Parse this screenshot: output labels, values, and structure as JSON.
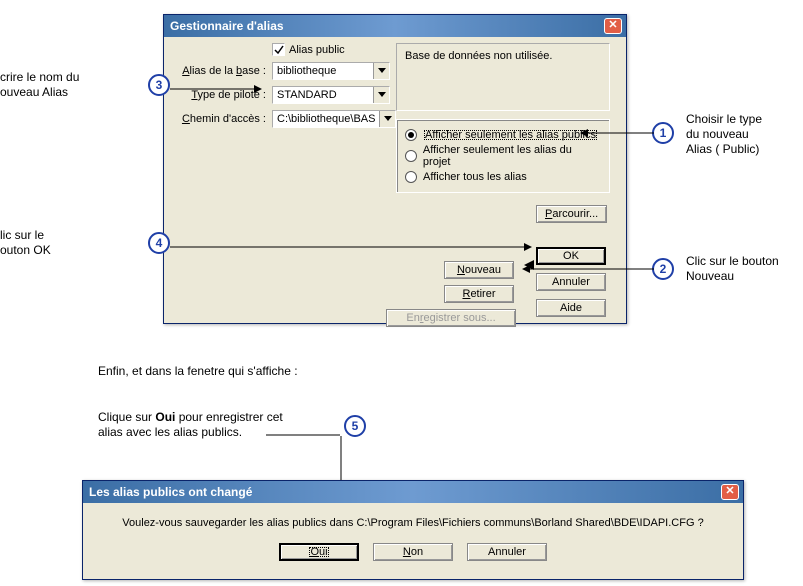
{
  "window1": {
    "title": "Gestionnaire d'alias",
    "publicCheckbox": {
      "label": "Alias public",
      "checked": true
    },
    "fields": {
      "aliasBaseLabel": "Alias de la base :",
      "aliasBaseValue": "bibliotheque",
      "typePiloteLabel": "Type de pilote :",
      "typePiloteValue": "STANDARD",
      "cheminLabel": "Chemin d'accès :",
      "cheminValue": "C:\\bibliotheque\\BASE_D"
    },
    "usageBox": "Base de données non utilisée.",
    "radios": {
      "r1": "Afficher seulement les alias publics",
      "r2": "Afficher seulement les alias du projet",
      "r3": "Afficher tous les alias",
      "selected": 0
    },
    "buttons": {
      "parcourir": "Parcourir...",
      "ok": "OK",
      "nouveau": "Nouveau",
      "annuler": "Annuler",
      "retirer": "Retirer",
      "enregistrer": "Enregistrer sous...",
      "aide": "Aide"
    }
  },
  "annotations": {
    "a3_l1": "crire le nom du",
    "a3_l2": "ouveau Alias",
    "a1_l1": "Choisir le type",
    "a1_l2": "du nouveau",
    "a1_l3": "Alias ( Public)",
    "a4_l1": "lic sur le",
    "a4_l2": "outon OK",
    "a2_l1": "Clic sur le bouton",
    "a2_l2": "Nouveau",
    "afterText": "Enfin, et dans la fenetre qui s'affiche :",
    "a5_l1_pre": "Clique sur ",
    "a5_l1_bold": "Oui",
    "a5_l1_post": " pour enregistrer cet",
    "a5_l2": "alias avec les alias publics."
  },
  "window2": {
    "title": "Les alias publics ont changé",
    "message": "Voulez-vous sauvegarder les alias publics dans C:\\Program Files\\Fichiers communs\\Borland Shared\\BDE\\IDAPI.CFG ?",
    "buttons": {
      "oui": "Oui",
      "non": "Non",
      "annuler": "Annuler"
    }
  },
  "numbers": {
    "n1": "1",
    "n2": "2",
    "n3": "3",
    "n4": "4",
    "n5": "5"
  }
}
